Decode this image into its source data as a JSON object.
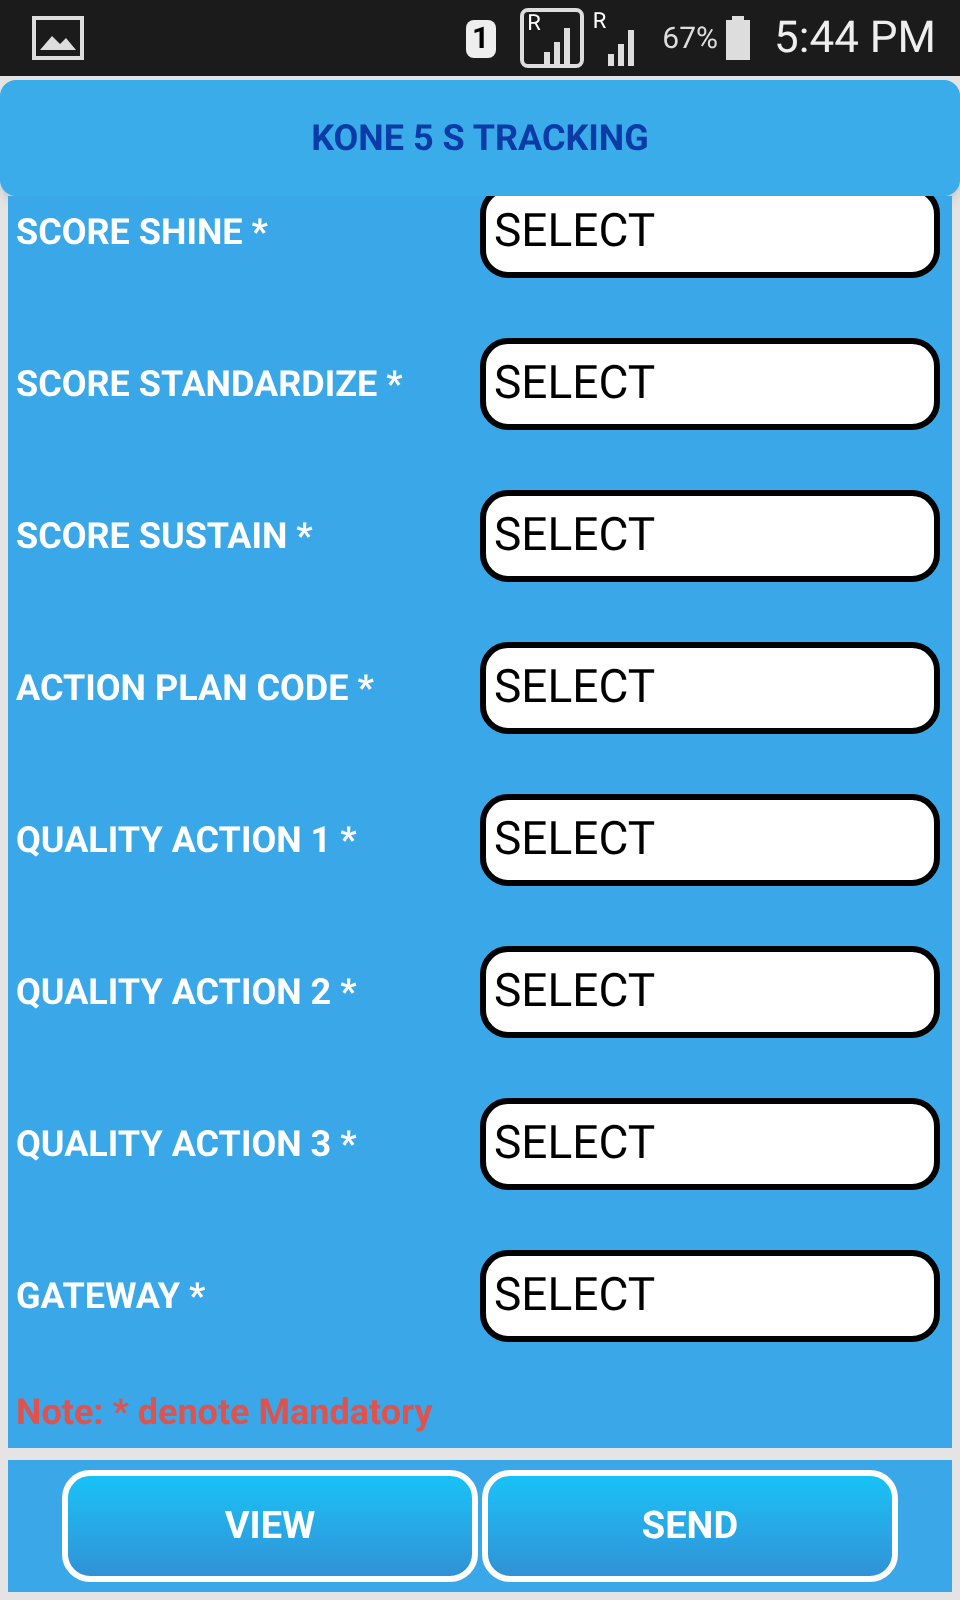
{
  "status_bar": {
    "sim": "1",
    "roaming": [
      "R",
      "R"
    ],
    "battery": "67%",
    "time": "5:44 PM"
  },
  "header": {
    "title": "KONE 5 S TRACKING"
  },
  "fields": [
    {
      "label": "SCORE SHINE *",
      "value": "SELECT"
    },
    {
      "label": "SCORE STANDARDIZE *",
      "value": "SELECT"
    },
    {
      "label": "SCORE SUSTAIN *",
      "value": "SELECT"
    },
    {
      "label": "ACTION PLAN CODE *",
      "value": "SELECT"
    },
    {
      "label": "QUALITY ACTION 1 *",
      "value": "SELECT"
    },
    {
      "label": "QUALITY ACTION 2 *",
      "value": "SELECT"
    },
    {
      "label": "QUALITY ACTION 3 *",
      "value": "SELECT"
    },
    {
      "label": "GATEWAY *",
      "value": "SELECT"
    }
  ],
  "note": "Note: * denote Mandatory",
  "buttons": [
    "VIEW",
    "SEND"
  ]
}
